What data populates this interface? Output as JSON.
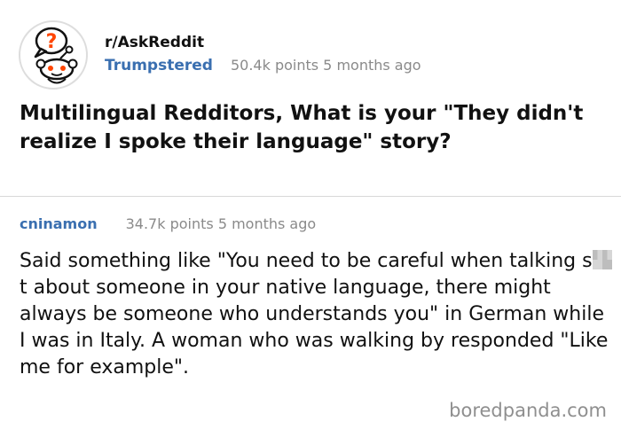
{
  "post": {
    "subreddit": "r/AskReddit",
    "author": "Trumpstered",
    "meta": "50.4k points 5 months ago",
    "title": "Multilingual Redditors, What is your \"They didn't realize I spoke their language\" story?",
    "avatar_icon": "reddit-alien-question-icon"
  },
  "comment": {
    "author": "cninamon",
    "meta": "34.7k points 5 months ago",
    "body_before_censor": "Said something like \"You need to be careful when talking s",
    "body_after_censor": "t about someone in your native language, there might always be someone who understands you\" in German while I was in Italy. A woman who was walking by responded \"Like me for example\"."
  },
  "watermark": "boredpanda.com",
  "colors": {
    "username": "#3a6fb0",
    "meta_gray": "#8a8a8a",
    "divider": "#d8d8d8",
    "accent_orange": "#ff4500"
  }
}
